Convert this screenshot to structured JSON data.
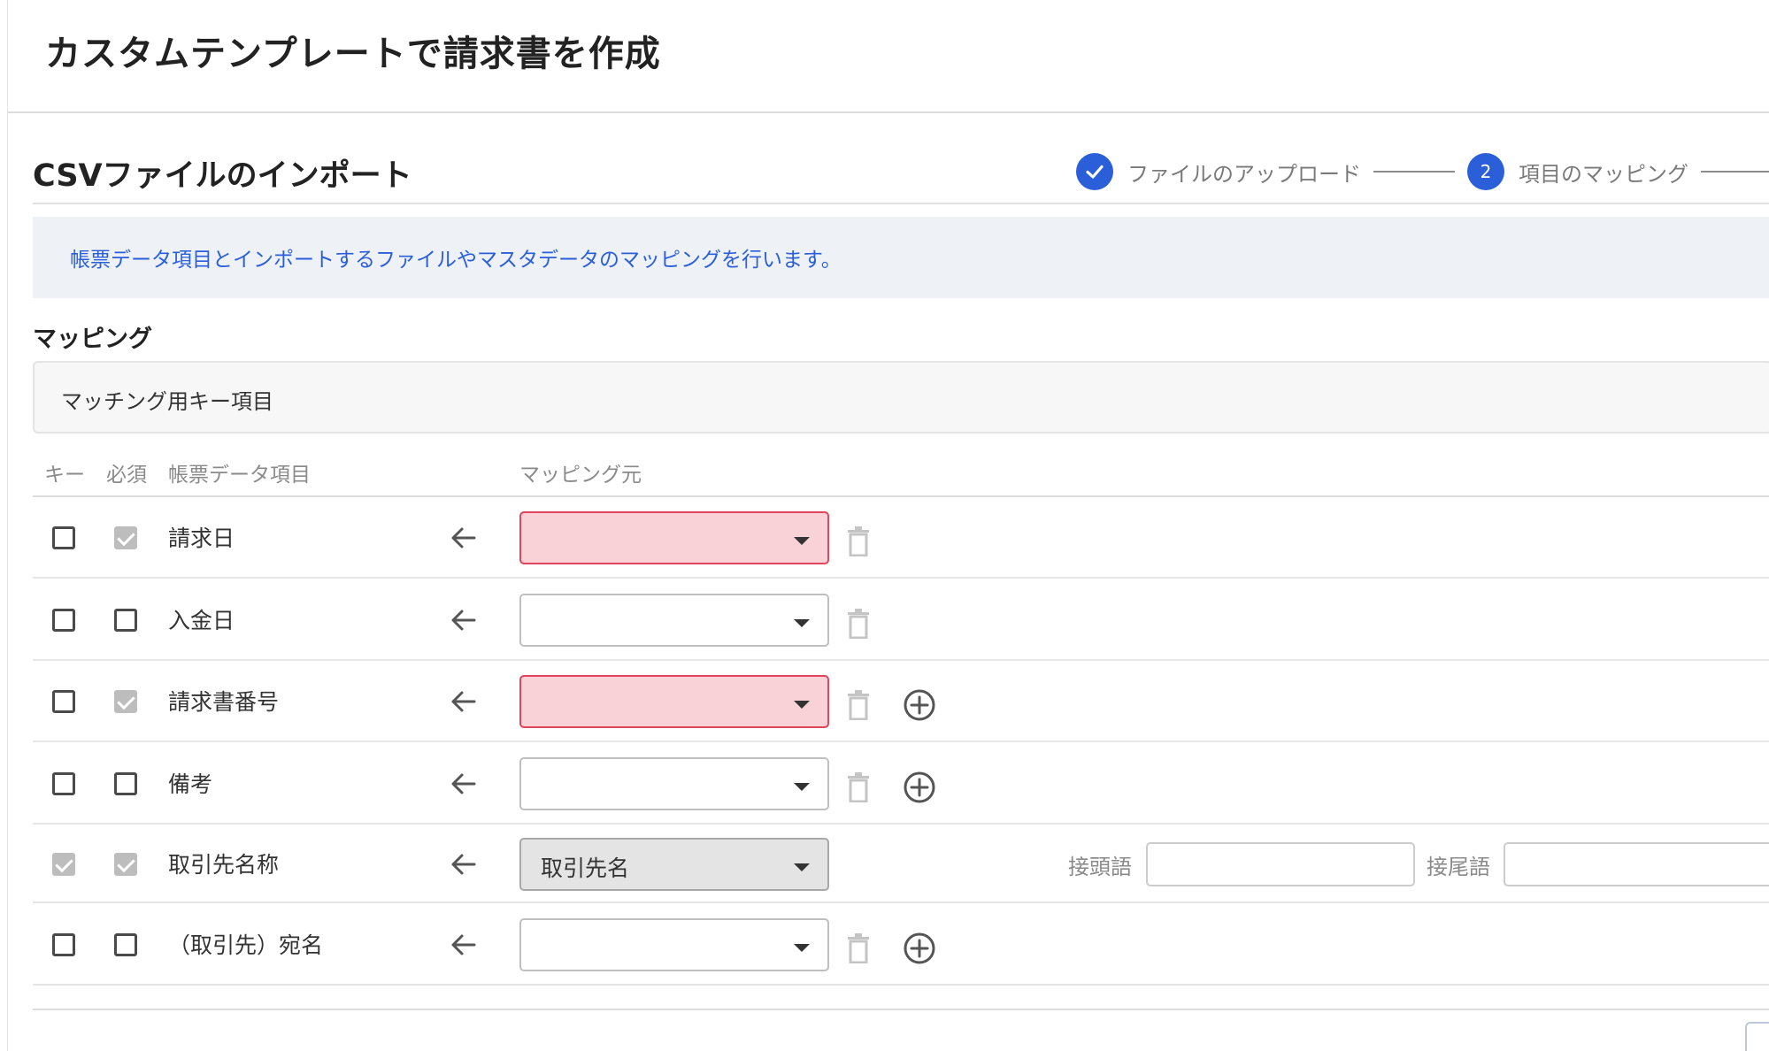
{
  "page": {
    "title": "カスタムテンプレートで請求書を作成"
  },
  "section": {
    "title": "CSVファイルのインポート"
  },
  "stepper": {
    "steps": [
      {
        "marker": "",
        "label": "ファイルのアップロード",
        "state": "complete"
      },
      {
        "marker": "2",
        "label": "項目のマッピング",
        "state": "current"
      }
    ]
  },
  "info": {
    "message": "帳票データ項目とインポートするファイルやマスタデータのマッピングを行います。"
  },
  "mapping": {
    "heading": "マッピング",
    "key_panel_title": "マッチング用キー項目",
    "columns": {
      "key": "キー",
      "required": "必須",
      "field": "帳票データ項目",
      "source": "マッピング元"
    },
    "rows": [
      {
        "key_checked": false,
        "required_checked": true,
        "label": "請求日",
        "source_value": "",
        "source_state": "error",
        "has_add": false,
        "has_affix": false
      },
      {
        "key_checked": false,
        "required_checked": false,
        "label": "入金日",
        "source_value": "",
        "source_state": "empty",
        "has_add": false,
        "has_affix": false
      },
      {
        "key_checked": false,
        "required_checked": true,
        "label": "請求書番号",
        "source_value": "",
        "source_state": "error",
        "has_add": true,
        "has_affix": false
      },
      {
        "key_checked": false,
        "required_checked": false,
        "label": "備考",
        "source_value": "",
        "source_state": "empty",
        "has_add": true,
        "has_affix": false
      },
      {
        "key_checked": true,
        "required_checked": true,
        "label": "取引先名称",
        "source_value": "取引先名",
        "source_state": "filled",
        "has_add": false,
        "has_affix": true,
        "prefix_label": "接頭語",
        "suffix_label": "接尾語",
        "prefix_value": "",
        "suffix_value": ""
      },
      {
        "key_checked": false,
        "required_checked": false,
        "label": "（取引先）宛名",
        "source_value": "",
        "source_state": "empty",
        "has_add": true,
        "has_affix": false
      }
    ]
  },
  "colors": {
    "accent": "#2b5fd9",
    "error_fill": "#f9d2d8",
    "error_border": "#e0455b",
    "info_bg": "#eef1f6"
  },
  "icons": {
    "step_complete": "check-icon",
    "arrow": "arrow-left-icon",
    "delete": "trash-icon",
    "add": "plus-circle-icon",
    "dropdown": "caret-down-icon"
  }
}
